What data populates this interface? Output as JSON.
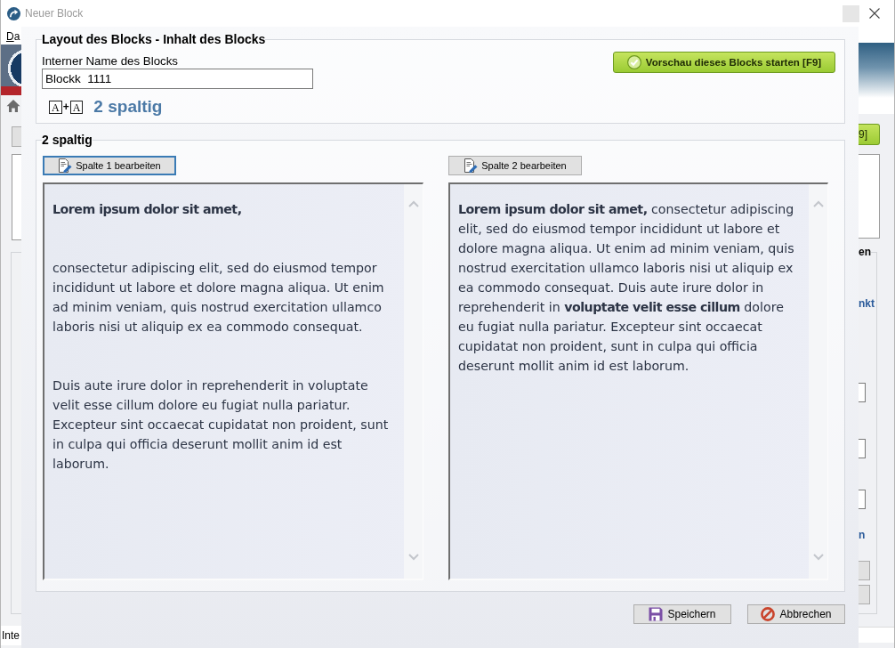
{
  "window": {
    "title": "Neuer Block"
  },
  "background_window": {
    "menu_label": "Da",
    "preview_button_fragment": "9]",
    "group_title_fragment": "en",
    "link_fragments": [
      "nkt",
      "n"
    ],
    "status_text": "Inte"
  },
  "layout_group": {
    "title": "Layout des Blocks - Inhalt des Blocks",
    "name_label": "Interner Name des Blocks",
    "name_value": "Blockk  1111",
    "layout_icon": [
      "A",
      "+",
      "A"
    ],
    "layout_name": "2 spaltig",
    "preview_button": "Vorschau dieses Blocks starten [F9]"
  },
  "columns_group": {
    "title": "2 spaltig",
    "columns": [
      {
        "edit_button": "Spalte 1 bearbeiten",
        "focused": true,
        "paragraphs": [
          {
            "text": "Lorem ipsum dolor sit amet,",
            "bold": true
          },
          {
            "text": "consectetur adipiscing elit, sed do eiusmod tempor incididunt ut labore et dolore magna aliqua. Ut enim ad minim veniam, quis nostrud exercitation ullamco laboris nisi ut aliquip ex ea commodo consequat.",
            "bold": false
          },
          {
            "text": "Duis aute irure dolor in reprehenderit in voluptate velit esse cillum dolore eu fugiat nulla pariatur. Excepteur sint occaecat cupidatat non proident, sunt in culpa qui officia deserunt mollit anim id est laborum.",
            "bold": false
          }
        ]
      },
      {
        "edit_button": "Spalte 2 bearbeiten",
        "focused": false,
        "paragraphs": [
          {
            "text": "**Lorem ipsum dolor sit amet,** consectetur adipiscing elit, sed do eiusmod tempor incididunt ut labore et dolore magna aliqua. Ut enim ad minim veniam, quis nostrud exercitation ullamco laboris nisi ut aliquip ex ea commodo consequat. Duis aute irure dolor in reprehenderit in **voluptate velit esse cillum** dolore eu fugiat nulla pariatur. Excepteur sint occaecat cupidatat non proident, sunt in culpa qui officia deserunt mollit anim id est laborum.",
            "bold": false
          }
        ]
      }
    ]
  },
  "buttons": [
    {
      "kind": "save",
      "label": "Speichern"
    },
    {
      "kind": "cancel",
      "label": "Abbrechen"
    }
  ]
}
